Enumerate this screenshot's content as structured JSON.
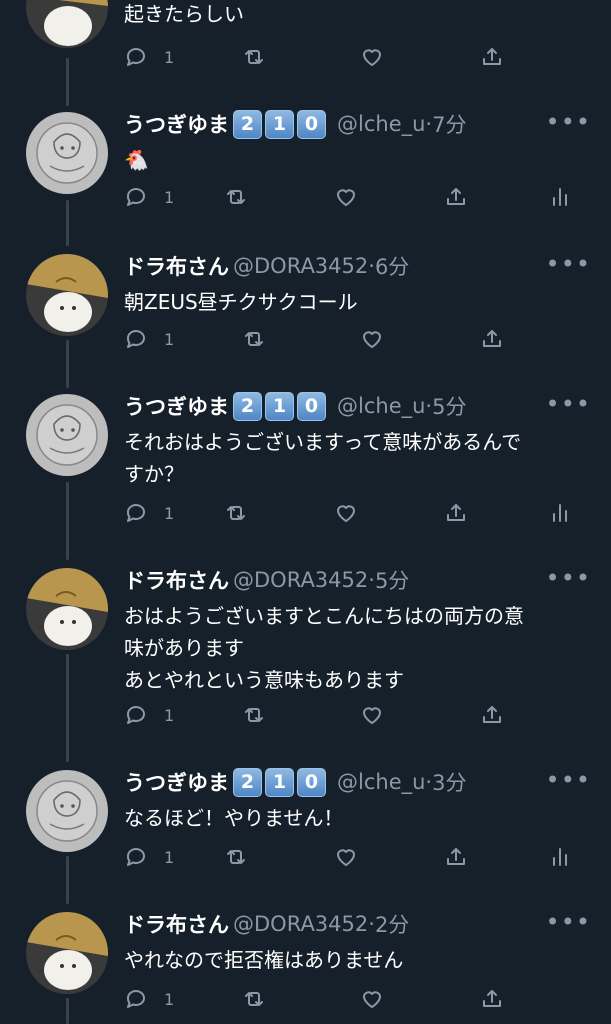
{
  "colors": {
    "background": "#15202b",
    "text": "#ffffff",
    "muted": "#8b98a5",
    "thread": "#38444d",
    "badge": "#6aa0d8"
  },
  "top_partial": {
    "text": "起きたらしい",
    "reply_count": "1"
  },
  "tweets": [
    {
      "name": "うつぎゆま",
      "badges": [
        "2",
        "1",
        "0"
      ],
      "handle": "@lche_u",
      "sep": "·",
      "time": "7分",
      "text": "🐔",
      "reply_count": "1",
      "avatar": "utsugi",
      "has_analytics": true
    },
    {
      "name": "ドラ布さん",
      "badges": [],
      "handle": "@DORA3452",
      "sep": "·",
      "time": "6分",
      "text": "朝ZEUS昼チクサクコール",
      "reply_count": "1",
      "avatar": "dora",
      "has_analytics": false
    },
    {
      "name": "うつぎゆま",
      "badges": [
        "2",
        "1",
        "0"
      ],
      "handle": "@lche_u",
      "sep": "·",
      "time": "5分",
      "text": "それおはようございますって意味があるんで\nすか？",
      "reply_count": "1",
      "avatar": "utsugi",
      "has_analytics": true
    },
    {
      "name": "ドラ布さん",
      "badges": [],
      "handle": "@DORA3452",
      "sep": "·",
      "time": "5分",
      "text": "おはようございますとこんにちはの両方の意\n味があります\nあとやれという意味もあります",
      "reply_count": "1",
      "avatar": "dora",
      "has_analytics": false
    },
    {
      "name": "うつぎゆま",
      "badges": [
        "2",
        "1",
        "0"
      ],
      "handle": "@lche_u",
      "sep": "·",
      "time": "3分",
      "text": "なるほど！やりません！",
      "reply_count": "1",
      "avatar": "utsugi",
      "has_analytics": true
    },
    {
      "name": "ドラ布さん",
      "badges": [],
      "handle": "@DORA3452",
      "sep": "·",
      "time": "2分",
      "text": "やれなので拒否権はありません",
      "reply_count": "1",
      "avatar": "dora",
      "has_analytics": false
    }
  ],
  "icons": {
    "more": "more-icon",
    "reply": "reply-icon",
    "retweet": "retweet-icon",
    "like": "heart-icon",
    "share": "share-icon",
    "analytics": "analytics-icon"
  },
  "more_glyph": "•••"
}
